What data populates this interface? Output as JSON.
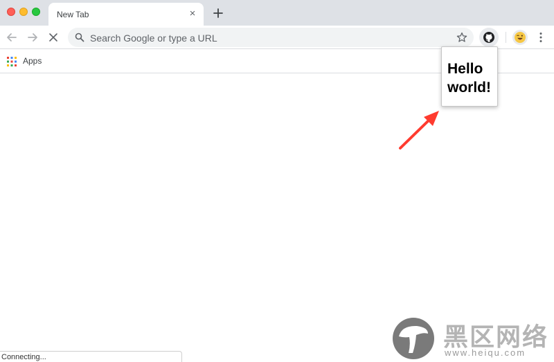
{
  "tab": {
    "title": "New Tab",
    "close_glyph": "×",
    "new_tab_icon": "plus-icon"
  },
  "toolbar": {
    "back_icon": "arrow-left-icon",
    "forward_icon": "arrow-right-icon",
    "stop_icon": "close-icon",
    "omnibox_placeholder": "Search Google or type a URL",
    "bookmark_star_icon": "star-icon",
    "extension_icon": "github-icon",
    "profile_icon": "emoji-avatar-icon",
    "menu_icon": "vertical-dots-icon"
  },
  "bookmarks": {
    "apps_label": "Apps",
    "apps_icon": "apps-grid-icon"
  },
  "popup": {
    "line1": "Hello",
    "line2": "world!"
  },
  "status": {
    "text": "Connecting..."
  },
  "watermark": {
    "text_cn": "黑区网络",
    "url": "www.heiqu.com"
  },
  "colors": {
    "tabstrip": "#dee1e6",
    "omnibox": "#f1f3f4",
    "arrow": "#ff3b2f",
    "traffic_red": "#ff5f57",
    "traffic_yellow": "#febc2e",
    "traffic_green": "#28c840"
  }
}
